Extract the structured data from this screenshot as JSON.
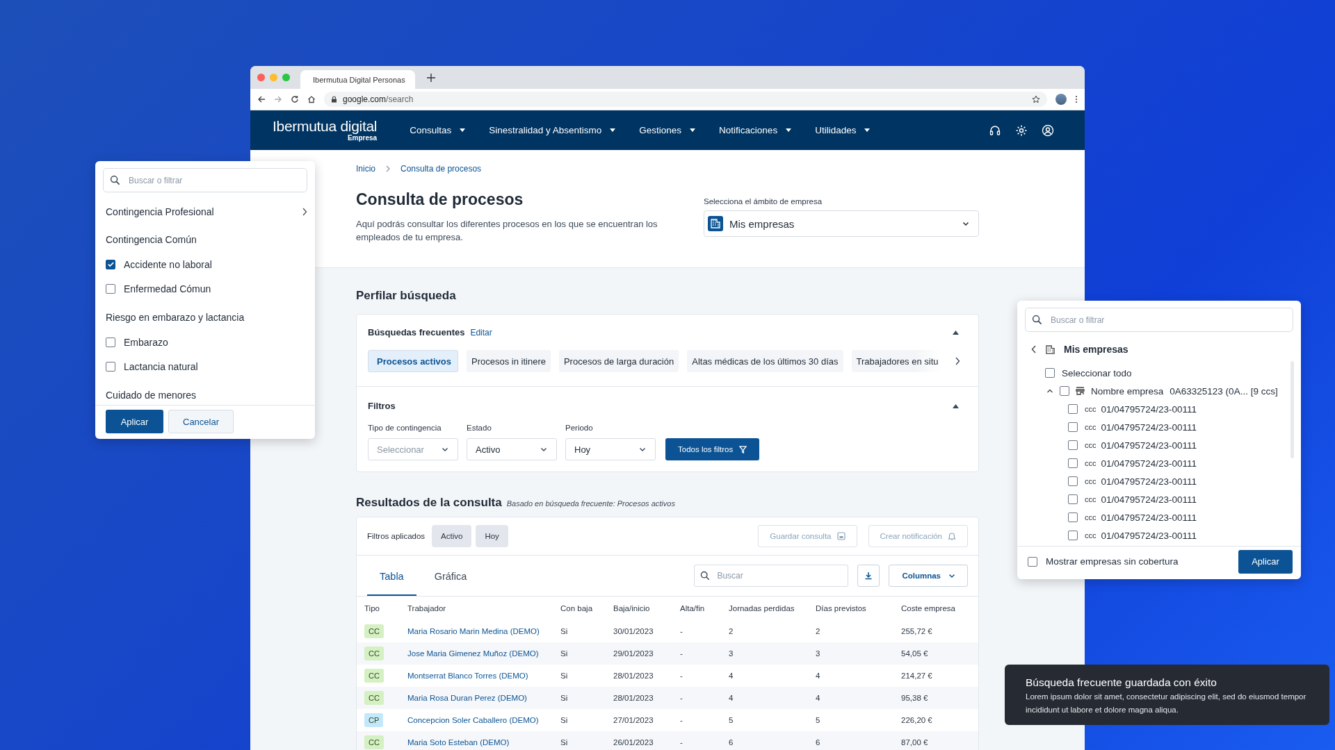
{
  "browser": {
    "tab_title": "Ibermutua Digital Personas",
    "url_host": "google.com",
    "url_path": "/search"
  },
  "header": {
    "logo": "Ibermutua digital",
    "logo_sub": "Empresa",
    "menu": [
      {
        "label": "Consultas"
      },
      {
        "label": "Sinestralidad y Absentismo"
      },
      {
        "label": "Gestiones"
      },
      {
        "label": "Notificaciones"
      },
      {
        "label": "Utilidades"
      }
    ]
  },
  "breadcrumb": [
    {
      "label": "Inicio"
    },
    {
      "label": "Consulta de procesos"
    }
  ],
  "page": {
    "title": "Consulta de procesos",
    "description": "Aquí podrás consultar los diferentes procesos en los que se encuentran los empleados de tu empresa.",
    "scope_label": "Selecciona el ámbito de empresa",
    "scope_value": "Mis empresas"
  },
  "profile": {
    "title": "Perfilar búsqueda",
    "frequent_title": "Búsquedas frecuentes",
    "edit_link": "Editar",
    "frequent": [
      {
        "label": "Procesos activos",
        "selected": true
      },
      {
        "label": "Procesos in itinere",
        "selected": false
      },
      {
        "label": "Procesos de larga duración",
        "selected": false
      },
      {
        "label": "Altas médicas de los últimos 30 días",
        "selected": false
      },
      {
        "label": "Trabajadores en situ",
        "selected": false
      }
    ],
    "filters_title": "Filtros",
    "filters": [
      {
        "label": "Tipo de contingencia",
        "placeholder": "Seleccionar"
      },
      {
        "label": "Estado",
        "value": "Activo"
      },
      {
        "label": "Periodo",
        "value": "Hoy"
      }
    ],
    "all_filters": "Todos los filtros"
  },
  "results": {
    "title": "Resultados de la consulta",
    "subtitle": "Basado en búsqueda frecuente: Procesos activos",
    "applied_label": "Filtros aplicados",
    "applied": [
      "Activo",
      "Hoy"
    ],
    "save_button": {
      "label": "Guardar consulta",
      "disabled": true
    },
    "notify_button": {
      "label": "Crear notificación",
      "disabled": true
    },
    "tabs": [
      {
        "label": "Tabla",
        "selected": true
      },
      {
        "label": "Gráfica",
        "selected": false
      }
    ],
    "search_placeholder": "Buscar",
    "columns_button": "Columnas",
    "table": {
      "columns": [
        "Tipo",
        "Trabajador",
        "Con baja",
        "Baja/inicio",
        "Alta/fin",
        "Jornadas perdidas",
        "Días previstos",
        "Coste empresa"
      ],
      "rows": [
        {
          "type": "CC",
          "color": "#d5f0c2",
          "worker": "Maria Rosario Marin Medina (DEMO)",
          "con_baja": "Si",
          "start": "30/01/2023",
          "end": "-",
          "lost": "2",
          "planned": "2",
          "cost": "255,72 €"
        },
        {
          "type": "CC",
          "color": "#d5f0c2",
          "worker": "Jose Maria Gimenez Muñoz (DEMO)",
          "con_baja": "Si",
          "start": "29/01/2023",
          "end": "-",
          "lost": "3",
          "planned": "3",
          "cost": "54,05 €"
        },
        {
          "type": "CC",
          "color": "#d5f0c2",
          "worker": "Montserrat Blanco Torres (DEMO)",
          "con_baja": "Si",
          "start": "28/01/2023",
          "end": "-",
          "lost": "4",
          "planned": "4",
          "cost": "214,27 €"
        },
        {
          "type": "CC",
          "color": "#d5f0c2",
          "worker": "Maria Rosa Duran Perez (DEMO)",
          "con_baja": "Si",
          "start": "28/01/2023",
          "end": "-",
          "lost": "4",
          "planned": "4",
          "cost": "95,38 €"
        },
        {
          "type": "CP",
          "color": "#c4e8fb",
          "worker": "Concepcion Soler Caballero (DEMO)",
          "con_baja": "Si",
          "start": "27/01/2023",
          "end": "-",
          "lost": "5",
          "planned": "5",
          "cost": "226,20 €"
        },
        {
          "type": "CC",
          "color": "#d5f0c2",
          "worker": "Maria Soto Esteban (DEMO)",
          "con_baja": "Si",
          "start": "26/01/2023",
          "end": "-",
          "lost": "6",
          "planned": "6",
          "cost": "87,00 €"
        }
      ]
    }
  },
  "filter_popup": {
    "search_placeholder": "Buscar o filtrar",
    "groups": [
      {
        "kind": "link",
        "title": "Contingencia Profesional"
      },
      {
        "kind": "group",
        "title": "Contingencia Común",
        "options": [
          {
            "label": "Accidente no laboral",
            "checked": true
          },
          {
            "label": "Enfermedad Cómun",
            "checked": false
          }
        ]
      },
      {
        "kind": "group",
        "title": "Riesgo en embarazo y lactancia",
        "options": [
          {
            "label": "Embarazo",
            "checked": false
          },
          {
            "label": "Lactancia natural",
            "checked": false
          }
        ]
      },
      {
        "kind": "group",
        "title": "Cuidado de menores"
      }
    ],
    "apply": "Aplicar",
    "cancel": "Cancelar"
  },
  "company_panel": {
    "search_placeholder": "Buscar o filtrar",
    "title": "Mis empresas",
    "select_all": {
      "label": "Seleccionar todo",
      "checked": false
    },
    "company": {
      "name": "Nombre empresa",
      "code": "0A63325123 (0A... [9 ccs]",
      "expanded": true,
      "checked": false,
      "children": [
        {
          "prefix": "ccc",
          "code": "01/04795724/23-00111",
          "checked": false
        },
        {
          "prefix": "ccc",
          "code": "01/04795724/23-00111",
          "checked": false
        },
        {
          "prefix": "ccc",
          "code": "01/04795724/23-00111",
          "checked": false
        },
        {
          "prefix": "ccc",
          "code": "01/04795724/23-00111",
          "checked": false
        },
        {
          "prefix": "ccc",
          "code": "01/04795724/23-00111",
          "checked": false
        },
        {
          "prefix": "ccc",
          "code": "01/04795724/23-00111",
          "checked": false
        },
        {
          "prefix": "ccc",
          "code": "01/04795724/23-00111",
          "checked": false
        },
        {
          "prefix": "ccc",
          "code": "01/04795724/23-00111",
          "checked": false
        }
      ]
    },
    "show_uncovered": {
      "label": "Mostrar empresas sin cobertura",
      "checked": false
    },
    "apply": "Aplicar"
  },
  "toast": {
    "title": "Búsqueda frecuente guardada con éxito",
    "body": "Lorem ipsum dolor sit amet, consectetur adipiscing elit, sed do eiusmod tempor incididunt ut labore et dolore magna aliqua."
  }
}
